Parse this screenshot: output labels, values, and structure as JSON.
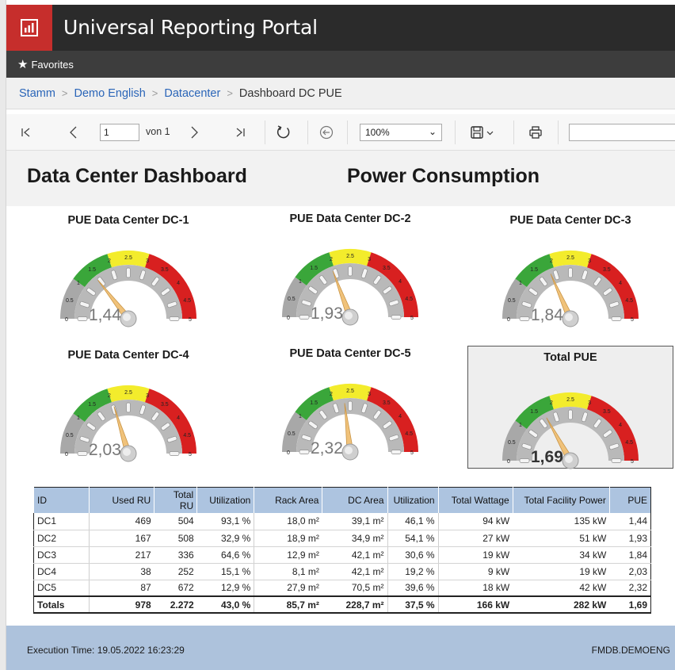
{
  "app": {
    "title": "Universal Reporting Portal",
    "logo_icon": "bar-chart-icon",
    "brand_color": "#c62e2c"
  },
  "favorites": {
    "label": "Favorites",
    "icon": "star-icon"
  },
  "breadcrumb": [
    {
      "label": "Stamm"
    },
    {
      "label": "Demo English"
    },
    {
      "label": "Datacenter"
    },
    {
      "label": "Dashboard DC PUE"
    }
  ],
  "toolbar": {
    "page_value": "1",
    "page_of": "von 1",
    "zoom": "100%",
    "icons": [
      "first-page-icon",
      "prev-page-icon",
      "next-page-icon",
      "last-page-icon",
      "refresh-icon",
      "back-icon",
      "save-icon",
      "print-icon"
    ]
  },
  "report": {
    "heading_left": "Data Center Dashboard",
    "heading_right": "Power Consumption"
  },
  "gauges": [
    {
      "title": "PUE Data Center DC-1",
      "value": 1.44,
      "label": "1,44"
    },
    {
      "title": "PUE Data Center DC-2",
      "value": 1.93,
      "label": "1,93"
    },
    {
      "title": "PUE Data Center DC-3",
      "value": 1.84,
      "label": "1,84"
    },
    {
      "title": "PUE Data Center DC-4",
      "value": 2.03,
      "label": "2,03"
    },
    {
      "title": "PUE Data Center DC-5",
      "value": 2.32,
      "label": "2,32"
    },
    {
      "title": "Total PUE",
      "value": 1.69,
      "label": "1,69"
    }
  ],
  "gauge_scale": {
    "min": 0,
    "max": 5,
    "tick_labels": [
      "0",
      "0.5",
      "1",
      "1.5",
      "2",
      "2.5",
      "3",
      "3.5",
      "4",
      "4.5",
      "5"
    ],
    "bands": [
      {
        "from": 0,
        "to": 1,
        "color": "#a8a8a8"
      },
      {
        "from": 1,
        "to": 2,
        "color": "#3aa63a"
      },
      {
        "from": 2,
        "to": 3,
        "color": "#f3ec2c"
      },
      {
        "from": 3,
        "to": 5,
        "color": "#d82020"
      }
    ]
  },
  "table": {
    "headers": [
      "ID",
      "Used RU",
      "Total RU",
      "Utilization",
      "Rack Area",
      "DC Area",
      "Utilization",
      "Total Wattage",
      "Total Facility Power",
      "PUE"
    ],
    "rows": [
      [
        "DC1",
        "469",
        "504",
        "93,1 %",
        "18,0 m²",
        "39,1 m²",
        "46,1 %",
        "94 kW",
        "135 kW",
        "1,44"
      ],
      [
        "DC2",
        "167",
        "508",
        "32,9 %",
        "18,9 m²",
        "34,9 m²",
        "54,1 %",
        "27 kW",
        "51 kW",
        "1,93"
      ],
      [
        "DC3",
        "217",
        "336",
        "64,6 %",
        "12,9 m²",
        "42,1 m²",
        "30,6 %",
        "19 kW",
        "34 kW",
        "1,84"
      ],
      [
        "DC4",
        "38",
        "252",
        "15,1 %",
        "8,1 m²",
        "42,1 m²",
        "19,2 %",
        "9 kW",
        "19 kW",
        "2,03"
      ],
      [
        "DC5",
        "87",
        "672",
        "12,9 %",
        "27,9 m²",
        "70,5 m²",
        "39,6 %",
        "18 kW",
        "42 kW",
        "2,32"
      ]
    ],
    "totals": [
      "Totals",
      "978",
      "2.272",
      "43,0 %",
      "85,7 m²",
      "228,7 m²",
      "37,5 %",
      "166 kW",
      "282 kW",
      "1,69"
    ]
  },
  "footer": {
    "execution": "Execution Time: 19.05.2022 16:23:29",
    "db": "FMDB.DEMOENG"
  }
}
